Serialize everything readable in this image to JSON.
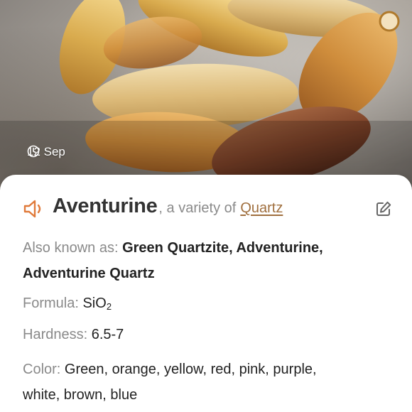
{
  "photo": {
    "date": "12 Sep",
    "icon": "clock-icon"
  },
  "mineral": {
    "name": "Aventurine",
    "variety_prefix": ", a variety of",
    "variety_link": "Quartz",
    "icons": {
      "audio": "speaker-icon",
      "edit": "edit-icon"
    },
    "accent_color": "#e07a3a",
    "link_color": "#a06f3e"
  },
  "details": {
    "aka_label": "Also known as:",
    "aka_value_line1": "Green Quartzite, Adventurine,",
    "aka_value_line2": "Adventurine Quartz",
    "formula_label": "Formula:",
    "formula_base": "SiO",
    "formula_sub": "2",
    "hardness_label": "Hardness:",
    "hardness_value": "6.5-7",
    "color_label": "Color:",
    "color_value_line1": "Green, orange, yellow, red, pink, purple,",
    "color_value_line2": "white, brown, blue"
  }
}
